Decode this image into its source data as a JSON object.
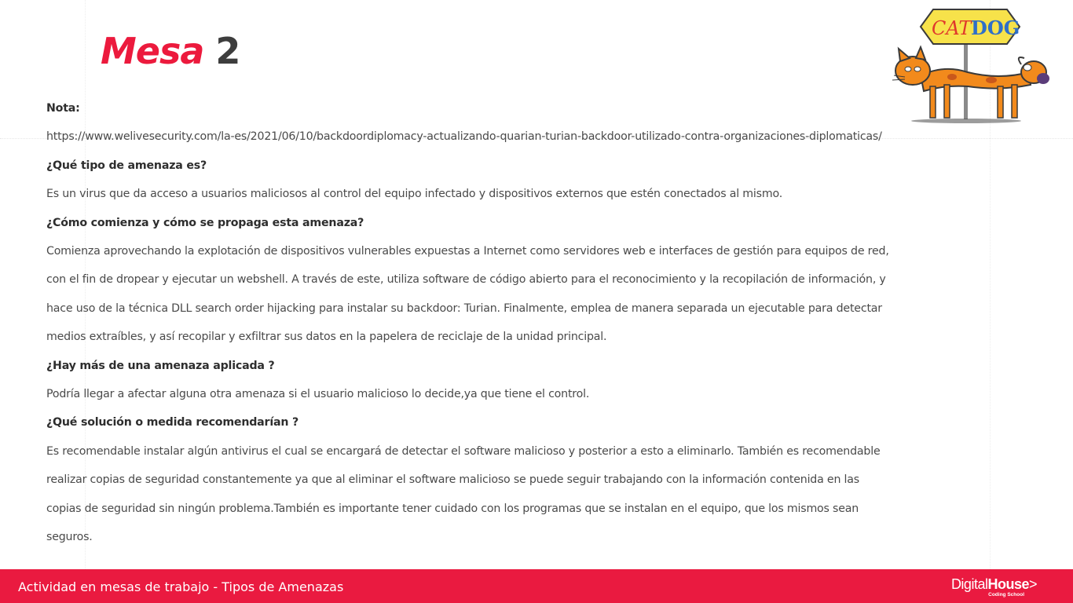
{
  "slide": {
    "title_word": "Mesa",
    "title_number": "2"
  },
  "logo": {
    "text_left": "CAT",
    "text_right": "DOG"
  },
  "content": {
    "note_label": "Nota:",
    "note_url": "https://www.welivesecurity.com/la-es/2021/06/10/backdoordiplomacy-actualizando-quarian-turian-backdoor-utilizado-contra-organizaciones-diplomaticas/",
    "q1": "¿Qué tipo de amenaza es?",
    "a1": [
      "Es un virus que da acceso a usuarios maliciosos al control del equipo infectado y dispositivos externos que estén conectados al mismo."
    ],
    "q2": "¿Cómo comienza y cómo se propaga esta amenaza?",
    "a2": [
      "Comienza aprovechando la explotación de dispositivos vulnerables expuestas a Internet como servidores web e interfaces de gestión para equipos de red,",
      "con el fin de dropear y ejecutar un webshell. A través de este, utiliza software de código abierto para el reconocimiento y la recopilación de información, y",
      "hace uso de la técnica DLL search order hijacking para instalar su backdoor: Turian. Finalmente, emplea de manera separada un ejecutable para detectar",
      "medios extraíbles, y así recopilar y exfiltrar sus datos en la papelera de reciclaje de la unidad principal."
    ],
    "q3": "¿Hay más de una amenaza aplicada ?",
    "a3": [
      "Podría llegar a afectar alguna otra amenaza si el usuario malicioso  lo decide,ya que tiene el control."
    ],
    "q4": "¿Qué solución o medida recomendarían ?",
    "a4": [
      "Es recomendable instalar algún antivirus el cual se encargará de detectar el software malicioso y posterior a esto a eliminarlo. También es recomendable",
      "realizar copias de seguridad constantemente ya que al eliminar el software malicioso se puede seguir trabajando con la información contenida en las",
      "copias de seguridad sin ningún problema.También es importante tener cuidado con los programas que se instalan en el equipo, que los mismos sean",
      "seguros."
    ]
  },
  "footer": {
    "text": "Actividad en mesas de trabajo - Tipos de Amenazas",
    "brand_light": "Digital",
    "brand_bold": "House",
    "brand_arrow": ">",
    "brand_sub": "Coding School"
  },
  "colors": {
    "accent": "#ea1a40",
    "title_number": "#3d3d3d",
    "body_text": "#4a4a4a"
  }
}
